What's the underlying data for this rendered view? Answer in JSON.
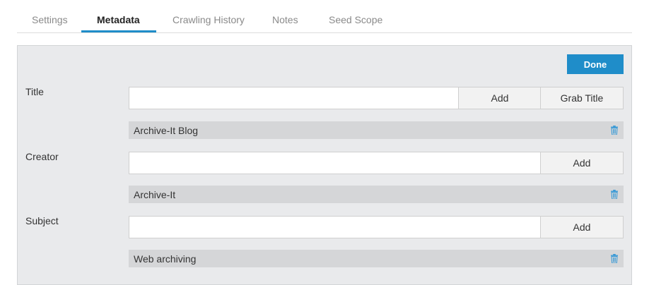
{
  "tabs": [
    {
      "label": "Settings",
      "active": false
    },
    {
      "label": "Metadata",
      "active": true
    },
    {
      "label": "Crawling History",
      "active": false
    },
    {
      "label": "Notes",
      "active": false
    },
    {
      "label": "Seed Scope",
      "active": false
    }
  ],
  "done_label": "Done",
  "fields": {
    "title": {
      "label": "Title",
      "input_value": "",
      "add_label": "Add",
      "grab_label": "Grab Title",
      "values": [
        "Archive-It Blog"
      ]
    },
    "creator": {
      "label": "Creator",
      "input_value": "",
      "add_label": "Add",
      "values": [
        "Archive-It"
      ]
    },
    "subject": {
      "label": "Subject",
      "input_value": "",
      "add_label": "Add",
      "values": [
        "Web archiving"
      ]
    }
  },
  "colors": {
    "accent": "#1f8dc9",
    "panel_bg": "#e9eaec",
    "value_row_bg": "#d5d6d8",
    "trash_icon": "#3c9bd6"
  },
  "icons": {
    "delete": "trash-icon"
  }
}
